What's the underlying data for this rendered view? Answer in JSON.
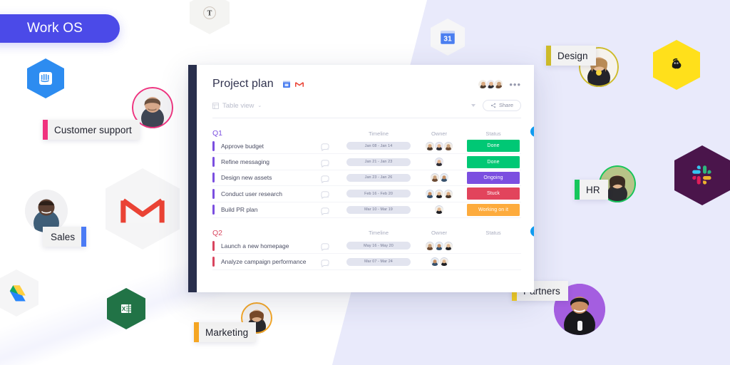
{
  "brand": {
    "pill_label": "Work OS",
    "pill_color": "#4b4ae8"
  },
  "background": {
    "left_color": "#ffffff",
    "right_color": "#e9eafb"
  },
  "board": {
    "title": "Project plan",
    "rail_color": "#292f4c",
    "header_apps": [
      "google-calendar-icon",
      "gmail-icon"
    ],
    "collaborators_count": 3,
    "more_menu_label": "•••",
    "toolbar": {
      "view_label": "Table view",
      "view_caret": "⌄",
      "share_label": "Share"
    },
    "columns": {
      "task": "",
      "timeline": "Timeline",
      "owner": "Owner",
      "status": "Status"
    },
    "add_button_label": "+",
    "groups": [
      {
        "name": "Q1",
        "color": "#7b4fe0",
        "rows": [
          {
            "task": "Approve budget",
            "timeline": "Jan 08 - Jan 14",
            "owners": 3,
            "status": "Done",
            "status_color": "#00c875"
          },
          {
            "task": "Refine messaging",
            "timeline": "Jan 21 - Jan 23",
            "owners": 1,
            "status": "Done",
            "status_color": "#00c875"
          },
          {
            "task": "Design new assets",
            "timeline": "Jan 23 - Jan 26",
            "owners": 2,
            "status": "Ongoing",
            "status_color": "#7b4fe0"
          },
          {
            "task": "Conduct user research",
            "timeline": "Feb 16 - Feb 20",
            "owners": 3,
            "status": "Stuck",
            "status_color": "#e2445c"
          },
          {
            "task": "Build PR plan",
            "timeline": "Mar 10 - Mar 19",
            "owners": 1,
            "status": "Working on it",
            "status_color": "#fdab3d"
          }
        ]
      },
      {
        "name": "Q2",
        "color": "#d9455f",
        "rows": [
          {
            "task": "Launch a new homepage",
            "timeline": "May 16 - May 20",
            "owners": 3,
            "status": "",
            "status_color": ""
          },
          {
            "task": "Analyze campaign performance",
            "timeline": "Mar 07 - Mar 24",
            "owners": 2,
            "status": "",
            "status_color": ""
          }
        ]
      }
    ]
  },
  "chips": [
    {
      "label": "Customer support",
      "color": "#f0337f",
      "bar_side": "left"
    },
    {
      "label": "Sales",
      "color": "#4b7bf5",
      "bar_side": "right"
    },
    {
      "label": "Marketing",
      "color": "#f5a623",
      "bar_side": "left"
    },
    {
      "label": "Design",
      "color": "#cdbb2a",
      "bar_side": "left"
    },
    {
      "label": "HR",
      "color": "#16c65c",
      "bar_side": "left"
    },
    {
      "label": "Partners",
      "color": "#f5cf22",
      "bar_side": "left"
    }
  ],
  "app_icons": [
    {
      "name": "intercom-icon",
      "color": "#2d8cf0"
    },
    {
      "name": "todoist-icon",
      "color": "#efece3"
    },
    {
      "name": "google-calendar-icon",
      "color": "#4a7ef0"
    },
    {
      "name": "mailchimp-icon",
      "color": "#ffe01b"
    },
    {
      "name": "slack-icon",
      "color": "#4a154b"
    },
    {
      "name": "gmail-icon",
      "color": "#ea4335"
    },
    {
      "name": "google-drive-icon",
      "color": "#0f9d58"
    },
    {
      "name": "microsoft-excel-icon",
      "color": "#217346"
    }
  ]
}
